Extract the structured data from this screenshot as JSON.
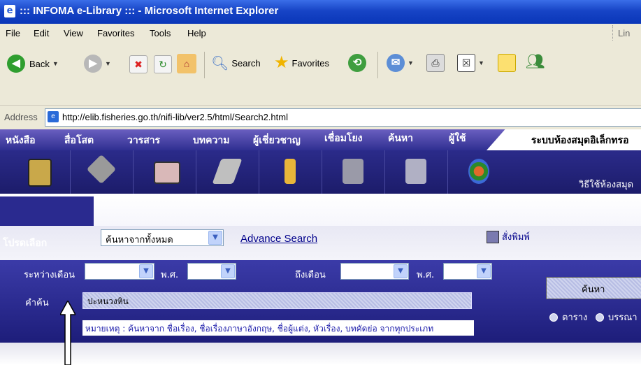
{
  "window": {
    "title": "::: INFOMA e-Library ::: - Microsoft Internet Explorer"
  },
  "menu": {
    "items": [
      "File",
      "Edit",
      "View",
      "Favorites",
      "Tools",
      "Help"
    ],
    "links_label": "Lin"
  },
  "toolbar": {
    "back": "Back",
    "search": "Search",
    "favorites": "Favorites"
  },
  "address": {
    "label": "Address",
    "url": "http://elib.fisheries.go.th/nifi-lib/ver2.5/html/Search2.html"
  },
  "nav": {
    "tabs": [
      "หนังสือ",
      "สื่อโสต",
      "วารสาร",
      "บทความ",
      "ผู้เชี่ยวชาญ",
      "เชื่อมโยง",
      "ค้นหา",
      "ผู้ใช้"
    ],
    "site_title": "ระบบห้องสมุดอิเล็กทรอ",
    "howto": "วิธีใช้ห้องสมุด"
  },
  "search": {
    "program_label": "โปรดเลือก",
    "scope_selected": "ค้นหาจากทั้งหมด",
    "advance_link": "Advance Search",
    "print_label": "สั่งพิมพ์",
    "between_month_label": "ระหว่างเดือน",
    "be_label_1": "พ.ศ.",
    "to_month_label": "ถึงเดือน",
    "be_label_2": "พ.ศ.",
    "keyword_label": "คำค้น",
    "keyword_value": "ปะหนวงหิน",
    "note": "หมายเหตุ : ค้นหาจาก ชื่อเรื่อง, ชื่อเรื่องภาษาอังกฤษ, ชื่อผู้แต่ง, หัวเรื่อง, บทคัดย่อ จากทุกประเภท",
    "search_button": "ค้นหา",
    "radio_table": "ตาราง",
    "radio_bib": "บรรณา"
  },
  "colors": {
    "nav_bg": "#2f2f91",
    "panel_bg": "#1d1d7a",
    "link": "#00008b"
  }
}
